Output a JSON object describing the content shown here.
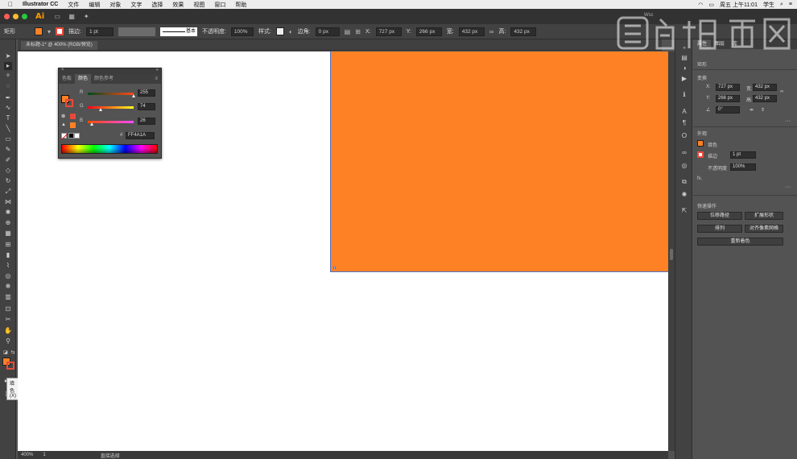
{
  "menubar": {
    "app": "Illustrator CC",
    "items": [
      "文件",
      "编辑",
      "对象",
      "文字",
      "选择",
      "效果",
      "视图",
      "窗口",
      "帮助"
    ],
    "clock": "周五 上午11:01",
    "user": "学生"
  },
  "appbar": {
    "logo": "Ai",
    "search_label": "Wsc"
  },
  "control": {
    "object_type": "矩形",
    "stroke_label": "描边:",
    "stroke_weight": "1 pt",
    "line_style": "基本",
    "opacity_label": "不透明度:",
    "opacity_value": "100%",
    "style_label": "样式:",
    "corner_label": "边角:",
    "corner_value": "0 px",
    "x_label": "X:",
    "x_value": "727 px",
    "y_label": "Y:",
    "y_value": "266 px",
    "w_label": "宽:",
    "w_value": "432 px",
    "h_label": "高:",
    "h_value": "432 px"
  },
  "document": {
    "tab_title": "未标题-1* @ 400% (RGB/预览)",
    "zoom": "400%",
    "page": "1",
    "status": "直接选择"
  },
  "tooltip": "填色(X)",
  "color_panel": {
    "tabs": [
      "色板",
      "颜色",
      "颜色参考"
    ],
    "active_tab": "颜色",
    "channels": [
      {
        "name": "R",
        "value": "255",
        "frac": 1.0
      },
      {
        "name": "G",
        "value": "74",
        "frac": 0.29
      },
      {
        "name": "B",
        "value": "26",
        "frac": 0.1
      }
    ],
    "hash": "#",
    "hex": "FF4A1A"
  },
  "properties": {
    "tabs": [
      "属性",
      "图层",
      "库"
    ],
    "section_object": "矩形",
    "section_transform": "变换",
    "x_label": "X:",
    "x_value": "727 px",
    "w_label": "宽:",
    "w_value": "432 px",
    "y_label": "Y:",
    "y_value": "266 px",
    "h_label": "高:",
    "h_value": "432 px",
    "rotate_value": "0°",
    "section_appearance": "外观",
    "fill_label": "填色",
    "stroke_label": "描边",
    "stroke_value": "1 pt",
    "opacity_label": "不透明度",
    "opacity_value": "100%",
    "fx_label": "fx.",
    "section_quick": "快速操作",
    "btn_offset": "位移路径",
    "btn_expand": "扩展形状",
    "btn_arrange": "排列",
    "btn_align": "对齐像素网格",
    "btn_recolor": "重新着色"
  },
  "colors": {
    "fill": "#FF8126",
    "stroke": "#e8493a",
    "accent_ai": "#ff9a00",
    "selection": "#4e73c9"
  }
}
